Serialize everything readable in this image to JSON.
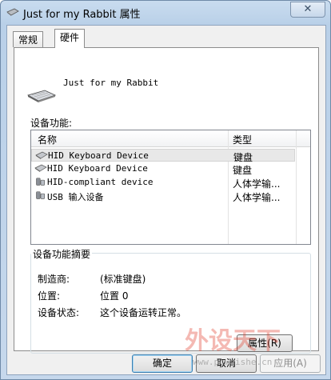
{
  "window": {
    "title": "Just for my Rabbit 属性",
    "close_glyph": "✕"
  },
  "tabs": [
    {
      "label": "常规"
    },
    {
      "label": "硬件"
    }
  ],
  "device": {
    "name": "Just for my Rabbit"
  },
  "functions": {
    "label": "设备功能:",
    "columns": {
      "name": "名称",
      "type": "类型"
    },
    "rows": [
      {
        "name": "HID Keyboard Device",
        "type": "键盘",
        "icon": "keyboard-icon",
        "selected": true
      },
      {
        "name": "HID Keyboard Device",
        "type": "键盘",
        "icon": "keyboard-icon",
        "selected": false
      },
      {
        "name": "HID-compliant device",
        "type": "人体学输...",
        "icon": "hid-device-icon",
        "selected": false
      },
      {
        "name": "USB 输入设备",
        "type": "人体学输...",
        "icon": "hid-device-icon",
        "selected": false
      }
    ]
  },
  "summary": {
    "title": "设备功能摘要",
    "manufacturer_label": "制造商:",
    "manufacturer_value": "(标准键盘)",
    "location_label": "位置:",
    "location_value": "位置 0",
    "status_label": "设备状态:",
    "status_value": "这个设备运转正常。",
    "properties_button": "属性(R)"
  },
  "buttons": {
    "ok": "确定",
    "cancel": "取消",
    "apply": "应用(A)"
  },
  "watermark": {
    "text": "www.pcwaishe.cn"
  }
}
